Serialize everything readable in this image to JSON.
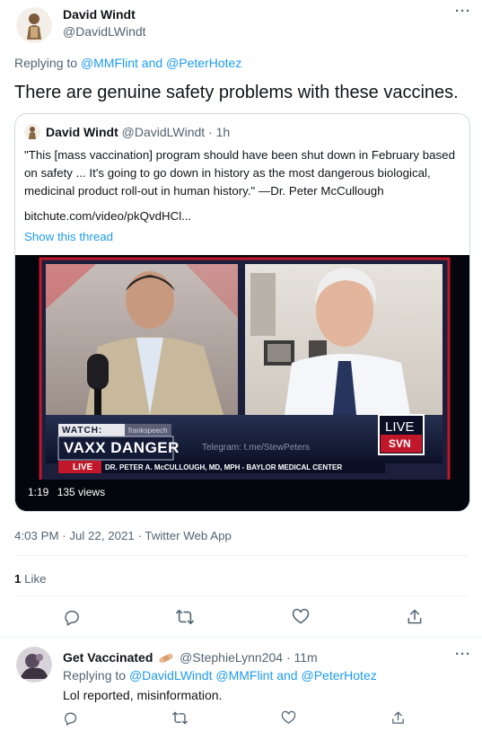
{
  "tweet": {
    "author_name": "David Windt",
    "author_handle": "@DavidLWindt",
    "replying_to_prefix": "Replying to ",
    "replying_to_users": "@MMFlint and @PeterHotez",
    "text": "There are genuine safety problems with these vaccines.",
    "meta": "4:03 PM · Jul 22, 2021 · Twitter Web App",
    "likes_count": "1",
    "likes_label": " Like"
  },
  "quote": {
    "author_name": "David Windt",
    "author_handle": "@DavidLWindt",
    "time": "· 1h",
    "text_line1": "\"This [mass vaccination] program should have been shut down in February based",
    "text_line2": "on safety ... It's going to go down in history as the most dangerous biological,",
    "text_line3": "medicinal product roll-out in human history.\" —Dr. Peter McCullough",
    "link_text": "bitchute.com/video/pkQvdHCl...",
    "show_thread": "Show this thread"
  },
  "video": {
    "watch_label": "WATCH:",
    "watch_sub": "frankspeech",
    "headline": "VAXX DANGER",
    "live_tag": "LIVE",
    "lower_third": "DR. PETER A. McCULLOUGH, MD, MPH - BAYLOR MEDICAL CENTER",
    "telegram": "Telegram: t.me/StewPeters",
    "live_logo_top": "LIVE",
    "live_logo_bottom": "SVN",
    "duration": "1:19",
    "views": "135 views"
  },
  "reply": {
    "author_name": "Get Vaccinated",
    "author_handle": "@StephieLynn204",
    "time": "· 11m",
    "replying_to_prefix": "Replying to ",
    "replying_to_users": "@DavidLWindt @MMFlint and @PeterHotez",
    "text": "Lol reported, misinformation."
  },
  "more_menu": "···",
  "colors": {
    "accent": "#1d9bf0",
    "muted": "#536471",
    "divider": "#eff3f4"
  },
  "icons": [
    "reply-icon",
    "retweet-icon",
    "like-icon",
    "share-icon",
    "more-icon",
    "bandage-emoji-icon"
  ]
}
